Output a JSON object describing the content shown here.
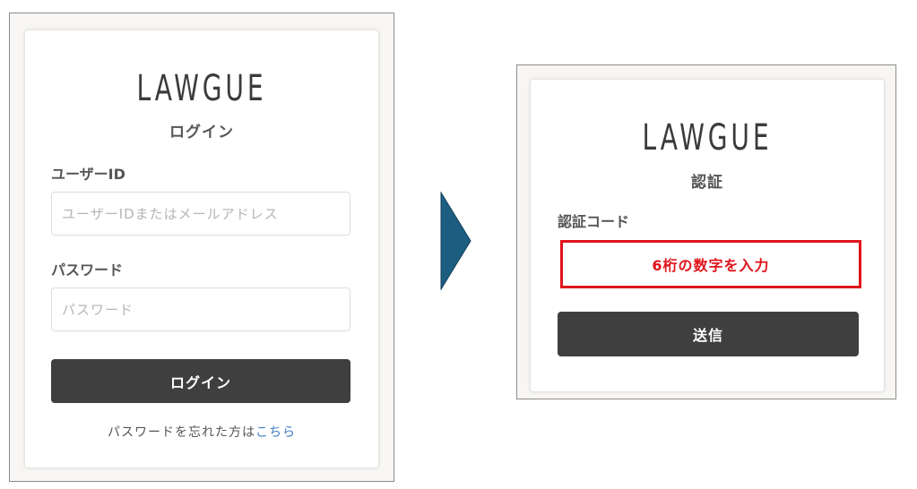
{
  "login": {
    "logo": "LAWGUE",
    "title": "ログイン",
    "user_id_label": "ユーザーID",
    "user_id_placeholder": "ユーザーIDまたはメールアドレス",
    "password_label": "パスワード",
    "password_placeholder": "パスワード",
    "submit_label": "ログイン",
    "forgot_text": "パスワードを忘れた方は",
    "forgot_link": "こちら"
  },
  "arrow": {
    "color": "#1d5e80"
  },
  "verify": {
    "logo": "LAWGUE",
    "title": "認証",
    "code_label": "認証コード",
    "code_annotation": "6桁の数字を入力",
    "submit_label": "送信"
  },
  "colors": {
    "button": "#3f3f3f",
    "link": "#3d7fc4",
    "highlight": "#e0141b"
  }
}
